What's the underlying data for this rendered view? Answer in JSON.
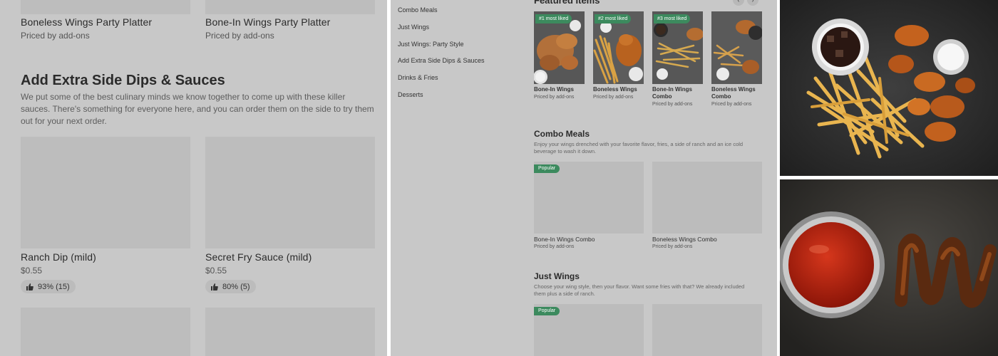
{
  "left_panel": {
    "top_cards": [
      {
        "name": "Boneless Wings Party Platter",
        "sub": "Priced by add-ons"
      },
      {
        "name": "Bone-In Wings Party Platter",
        "sub": "Priced by add-ons"
      }
    ],
    "section_title": "Add Extra Side Dips & Sauces",
    "section_desc": "We put some of the best culinary minds we know together to come up with these killer sauces. There's something for everyone here, and you can order them on the side to try them out for your next order.",
    "dip_cards": [
      {
        "name": "Ranch Dip (mild)",
        "price": "$0.55",
        "rating": "93% (15)"
      },
      {
        "name": "Secret Fry Sauce (mild)",
        "price": "$0.55",
        "rating": "80% (5)"
      }
    ]
  },
  "mid_panel": {
    "categories": [
      "Combo Meals",
      "Just Wings",
      "Just Wings: Party Style",
      "Add Extra Side Dips & Sauces",
      "Drinks & Fries",
      "Desserts"
    ],
    "featured_title": "Featured Items",
    "featured": [
      {
        "badge": "#1 most liked",
        "name": "Bone-In Wings",
        "sub": "Priced by add-ons"
      },
      {
        "badge": "#2 most liked",
        "name": "Boneless Wings",
        "sub": "Priced by add-ons"
      },
      {
        "badge": "#3 most liked",
        "name": "Bone-In Wings Combo",
        "sub": "Priced by add-ons"
      },
      {
        "badge": "",
        "name": "Boneless Wings Combo",
        "sub": "Priced by add-ons"
      }
    ],
    "combo": {
      "title": "Combo Meals",
      "desc": "Enjoy your wings drenched with your favorite flavor, fries, a side of ranch and an ice cold beverage to wash it down.",
      "cards": [
        {
          "badge": "Popular",
          "name": "Bone-In Wings Combo",
          "sub": "Priced by add-ons"
        },
        {
          "badge": "",
          "name": "Boneless Wings Combo",
          "sub": "Priced by add-ons"
        }
      ]
    },
    "just_wings": {
      "title": "Just Wings",
      "desc": "Choose your wing style, then your flavor. Want some fries with that? We already included them plus a side of ranch.",
      "cards": [
        {
          "badge": "Popular"
        },
        {
          "badge": ""
        }
      ]
    }
  },
  "colors": {
    "overlay_gray": "#c8c8c8",
    "placeholder": "#bdbdbd",
    "badge_green": "#3c8a5e"
  }
}
